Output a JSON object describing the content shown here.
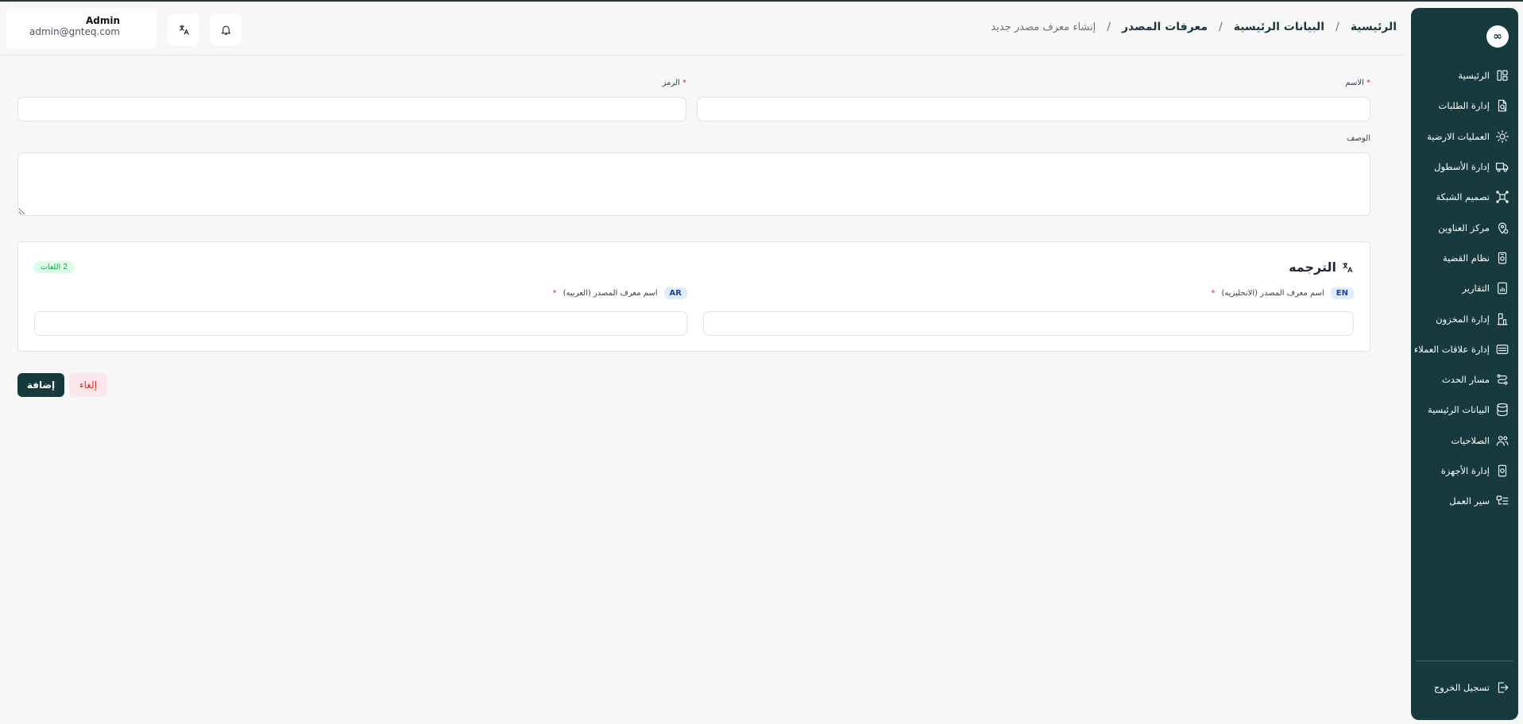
{
  "user": {
    "name": "Admin",
    "email": "admin@gnteq.com"
  },
  "breadcrumb": {
    "home": "الرئيسية",
    "master_data": "البيانات الرئيسية",
    "source_ids": "معرفات المصدر",
    "current": "إنشاء معرف مصدر جديد",
    "sep": "/"
  },
  "sidebar": {
    "logo": "∞",
    "items": [
      {
        "label": "الرئيسية",
        "icon": "layout-icon"
      },
      {
        "label": "إدارة الطلبات",
        "icon": "file-search-icon"
      },
      {
        "label": "العمليات الارضية",
        "icon": "sun-gear-icon"
      },
      {
        "label": "إدارة الأسطول",
        "icon": "truck-icon"
      },
      {
        "label": "تصميم الشبكة",
        "icon": "network-icon"
      },
      {
        "label": "مركز العناوين",
        "icon": "map-pin-icon"
      },
      {
        "label": "نظام القضية",
        "icon": "case-icon"
      },
      {
        "label": "التقارير",
        "icon": "report-icon"
      },
      {
        "label": "إدارة المخزون",
        "icon": "warehouse-icon"
      },
      {
        "label": "إدارة علاقات العملاء",
        "icon": "crm-icon"
      },
      {
        "label": "مسار الحدث",
        "icon": "route-icon"
      },
      {
        "label": "البيانات الرئيسية",
        "icon": "database-icon"
      },
      {
        "label": "الصلاحيات",
        "icon": "users-icon"
      },
      {
        "label": "إدارة الأجهزة",
        "icon": "device-icon"
      },
      {
        "label": "سير العمل",
        "icon": "workflow-icon"
      }
    ],
    "logout": "تسجيل الخروج"
  },
  "form": {
    "name_label": "الاسم",
    "code_label": "الرمز",
    "desc_label": "الوصف",
    "required_mark": "*",
    "name_value": "",
    "code_value": "",
    "desc_value": ""
  },
  "translation": {
    "title": "الترجمه",
    "lang_count": "2 اللغات",
    "en_tag": "EN",
    "en_label": "اسم معرف المصدر (الانجليزيه)",
    "ar_tag": "AR",
    "ar_label": "اسم معرف المصدر (العربيه)"
  },
  "actions": {
    "add": "إضافة",
    "cancel": "إلغاء"
  }
}
